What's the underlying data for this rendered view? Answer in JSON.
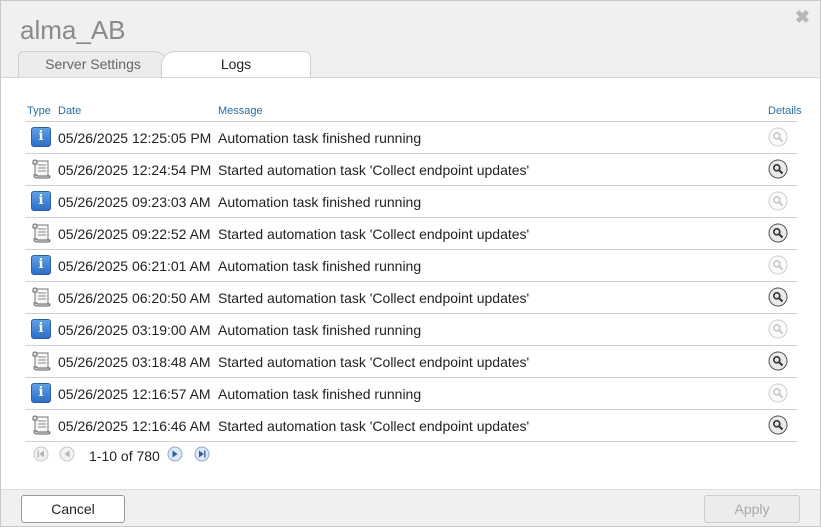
{
  "dialog": {
    "title": "alma_AB",
    "close_glyph": "✖"
  },
  "tabs": [
    {
      "label": "Server Settings",
      "active": false
    },
    {
      "label": "Logs",
      "active": true
    }
  ],
  "table": {
    "columns": {
      "type": "Type",
      "date": "Date",
      "message": "Message",
      "details": "Details"
    },
    "rows": [
      {
        "type": "info",
        "date": "05/26/2025 12:25:05 PM",
        "message": "Automation task finished running",
        "details_enabled": false
      },
      {
        "type": "scroll",
        "date": "05/26/2025 12:24:54 PM",
        "message": "Started automation task 'Collect endpoint updates'",
        "details_enabled": true
      },
      {
        "type": "info",
        "date": "05/26/2025 09:23:03 AM",
        "message": "Automation task finished running",
        "details_enabled": false
      },
      {
        "type": "scroll",
        "date": "05/26/2025 09:22:52 AM",
        "message": "Started automation task 'Collect endpoint updates'",
        "details_enabled": true
      },
      {
        "type": "info",
        "date": "05/26/2025 06:21:01 AM",
        "message": "Automation task finished running",
        "details_enabled": false
      },
      {
        "type": "scroll",
        "date": "05/26/2025 06:20:50 AM",
        "message": "Started automation task 'Collect endpoint updates'",
        "details_enabled": true
      },
      {
        "type": "info",
        "date": "05/26/2025 03:19:00 AM",
        "message": "Automation task finished running",
        "details_enabled": false
      },
      {
        "type": "scroll",
        "date": "05/26/2025 03:18:48 AM",
        "message": "Started automation task 'Collect endpoint updates'",
        "details_enabled": true
      },
      {
        "type": "info",
        "date": "05/26/2025 12:16:57 AM",
        "message": "Automation task finished running",
        "details_enabled": false
      },
      {
        "type": "scroll",
        "date": "05/26/2025 12:16:46 AM",
        "message": "Started automation task 'Collect endpoint updates'",
        "details_enabled": true
      }
    ]
  },
  "pager": {
    "range_text": "1-10 of 780"
  },
  "footer": {
    "cancel_label": "Cancel",
    "apply_label": "Apply"
  },
  "colors": {
    "header_text": "#2a6d9e",
    "info_icon": "#2c6fc7",
    "disabled_text": "#aaaaaa"
  }
}
